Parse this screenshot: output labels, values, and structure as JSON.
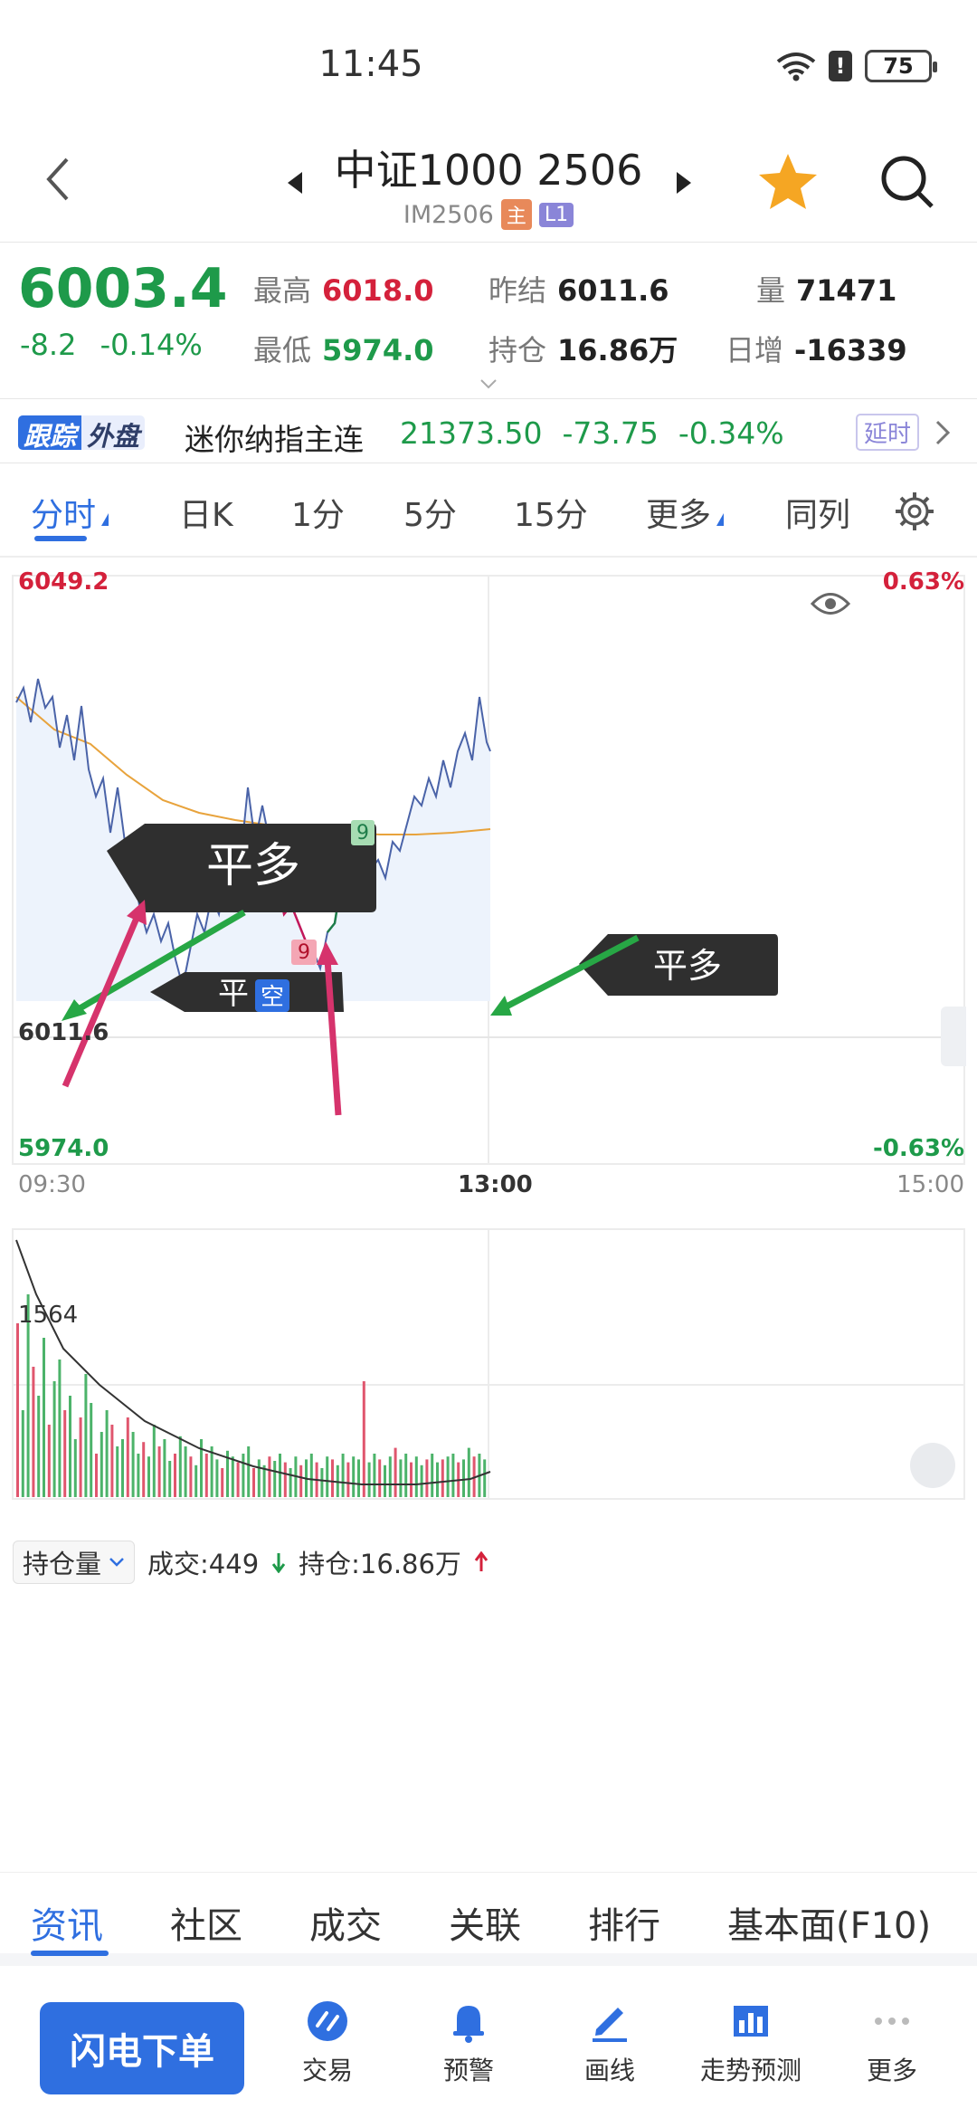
{
  "status": {
    "time": "11:45",
    "battery": "75"
  },
  "header": {
    "title": "中证1000 2506",
    "code": "IM2506",
    "tag_main": "主",
    "tag_level": "L1"
  },
  "quote": {
    "price": "6003.4",
    "change": "-8.2",
    "change_pct": "-0.14%",
    "high_label": "最高",
    "high": "6018.0",
    "low_label": "最低",
    "low": "5974.0",
    "prev_settle_label": "昨结",
    "prev_settle": "6011.6",
    "open_int_label": "持仓",
    "open_int": "16.86万",
    "volume_label": "量",
    "volume": "71471",
    "daily_inc_label": "日增",
    "daily_inc": "-16339"
  },
  "ticker": {
    "badge1": "跟踪",
    "badge2": "外盘",
    "name": "迷你纳指主连",
    "price": "21373.50",
    "change": "-73.75",
    "change_pct": "-0.34%",
    "delay_label": "延时"
  },
  "tabs": [
    "分时",
    "日K",
    "1分",
    "5分",
    "15分",
    "更多",
    "同列"
  ],
  "chart": {
    "top_price": "6049.2",
    "top_pct": "0.63%",
    "mid_price": "6011.6",
    "bottom_price": "5974.0",
    "bottom_pct": "-0.63%",
    "time_start": "09:30",
    "time_mid": "13:00",
    "time_end": "15:00",
    "annot_close_long": "平多",
    "annot_close_long2": "平多",
    "annot_close_short_a": "平",
    "annot_close_short_b": "空",
    "marker_9a": "9",
    "marker_9b": "9",
    "vol_ref": "1564",
    "colors": {
      "up": "#d4213b",
      "down": "#1e9a4a",
      "price_line": "#4a63a8",
      "avg_line": "#e8a33c"
    }
  },
  "volume": {
    "selector": "持仓量",
    "trade_text": "成交:449",
    "oi_text": "持仓:16.86万"
  },
  "bottom_tabs": [
    "资讯",
    "社区",
    "成交",
    "关联",
    "排行",
    "基本面(F10)"
  ],
  "bottom_nav": {
    "flash_order": "闪电下单",
    "items": [
      "交易",
      "预警",
      "画线",
      "走势预测",
      "更多"
    ]
  }
}
